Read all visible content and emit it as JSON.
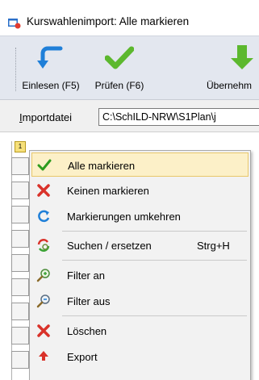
{
  "window": {
    "title": "Kurswahlenimport: Alle markieren",
    "app_icon": "app-window-icon"
  },
  "toolbar": {
    "buttons": [
      {
        "label": "Einlesen (F5)",
        "icon": "import-arrow-icon"
      },
      {
        "label": "Prüfen (F6)",
        "icon": "checkmark-icon"
      },
      {
        "label": "Übernehm",
        "icon": "download-arrow-icon"
      }
    ]
  },
  "import": {
    "label_underlined": "I",
    "label_rest": "mportdatei",
    "path": "C:\\SchILD-NRW\\S1Plan\\j"
  },
  "grid": {
    "corner_label": "1"
  },
  "context_menu": {
    "items": [
      {
        "label": "Alle markieren",
        "icon": "green-check-icon",
        "highlighted": true
      },
      {
        "label": "Keinen markieren",
        "icon": "red-x-icon"
      },
      {
        "label": "Markierungen umkehren",
        "icon": "invert-cycle-icon"
      },
      {
        "label": "Suchen / ersetzen",
        "shortcut": "Strg+H",
        "icon": "search-replace-icon"
      },
      {
        "label": "Filter an",
        "icon": "filter-on-icon"
      },
      {
        "label": "Filter aus",
        "icon": "filter-off-icon"
      },
      {
        "label": "Löschen",
        "icon": "delete-x-icon"
      },
      {
        "label": "Export",
        "icon": "export-arrow-icon"
      }
    ]
  },
  "colors": {
    "toolbar_bg": "#e3e7ef",
    "menu_highlight": "#fcf0c8",
    "check_green": "#5cb82e",
    "delete_red": "#d9322a",
    "import_blue": "#1f7fd8"
  }
}
